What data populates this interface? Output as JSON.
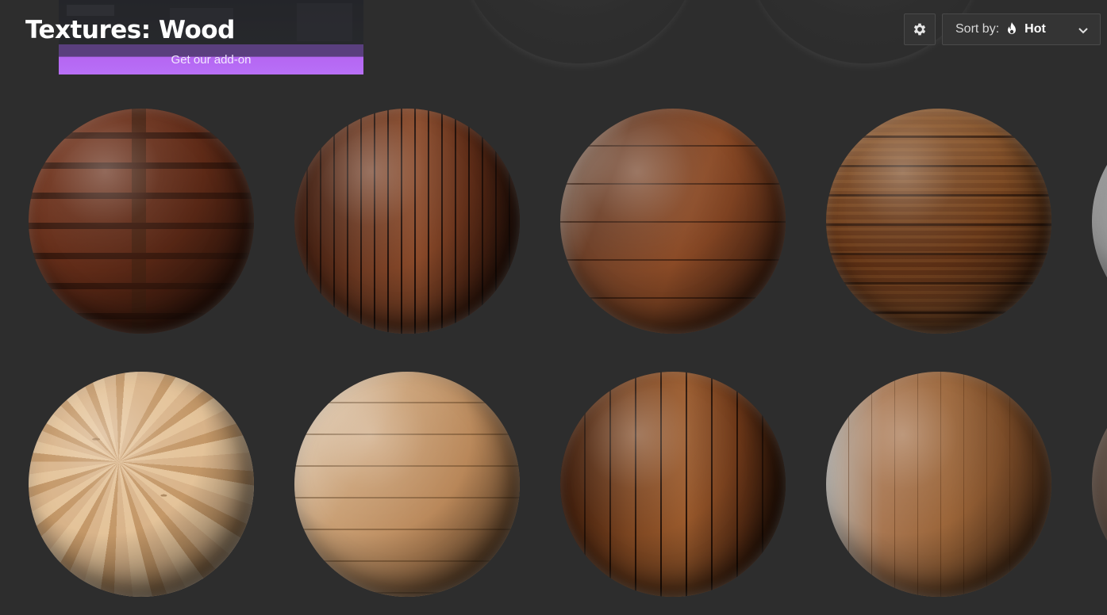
{
  "header": {
    "title": "Textures: Wood",
    "settings_icon": "gear-icon",
    "sort": {
      "label": "Sort by:",
      "icon": "flame-icon",
      "value": "Hot",
      "dropdown_icon": "chevron-down-icon"
    }
  },
  "banner": {
    "label": "Get our add-on",
    "accent": "#b870f7"
  },
  "grid": {
    "background": "#2d2d2d",
    "tiles": [
      {
        "material": "wood-panels"
      },
      {
        "material": "wood-planks-vertical"
      },
      {
        "material": "worn-wood"
      },
      {
        "material": "rough-wood-planks"
      },
      {
        "material": "partial-next-row-1"
      },
      {
        "material": "osb-board"
      },
      {
        "material": "light-wood-floor"
      },
      {
        "material": "nailed-wood-planks"
      },
      {
        "material": "oak-floor"
      },
      {
        "material": "partial-next-row-2"
      }
    ]
  }
}
